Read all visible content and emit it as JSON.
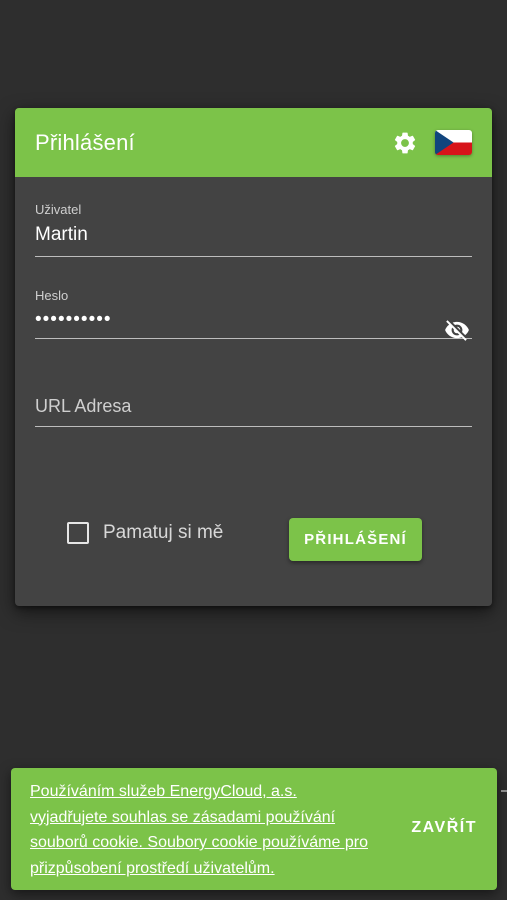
{
  "login": {
    "title": "Přihlášení",
    "settings_icon": "gear-icon",
    "language_icon": "czech-flag-icon",
    "username": {
      "label": "Uživatel",
      "value": "Martin"
    },
    "password": {
      "label": "Heslo",
      "masked_value": "••••••••••",
      "toggle_icon": "eye-off-icon"
    },
    "url": {
      "placeholder": "URL Adresa",
      "value": ""
    },
    "remember_me": {
      "label": "Pamatuj si mě",
      "checked": false
    },
    "submit_label": "PŘIHLÁŠENÍ"
  },
  "cookie_bar": {
    "text": "Používáním služeb EnergyCloud, a.s. vyjadřujete souhlas se zásadami používání souborů cookie. Soubory cookie používáme pro přizpůsobení prostředí uživatelům.",
    "close_label": "ZAVŘÍT"
  },
  "colors": {
    "accent": "#7cc349",
    "background": "#2e2e2e",
    "card": "#434343"
  }
}
